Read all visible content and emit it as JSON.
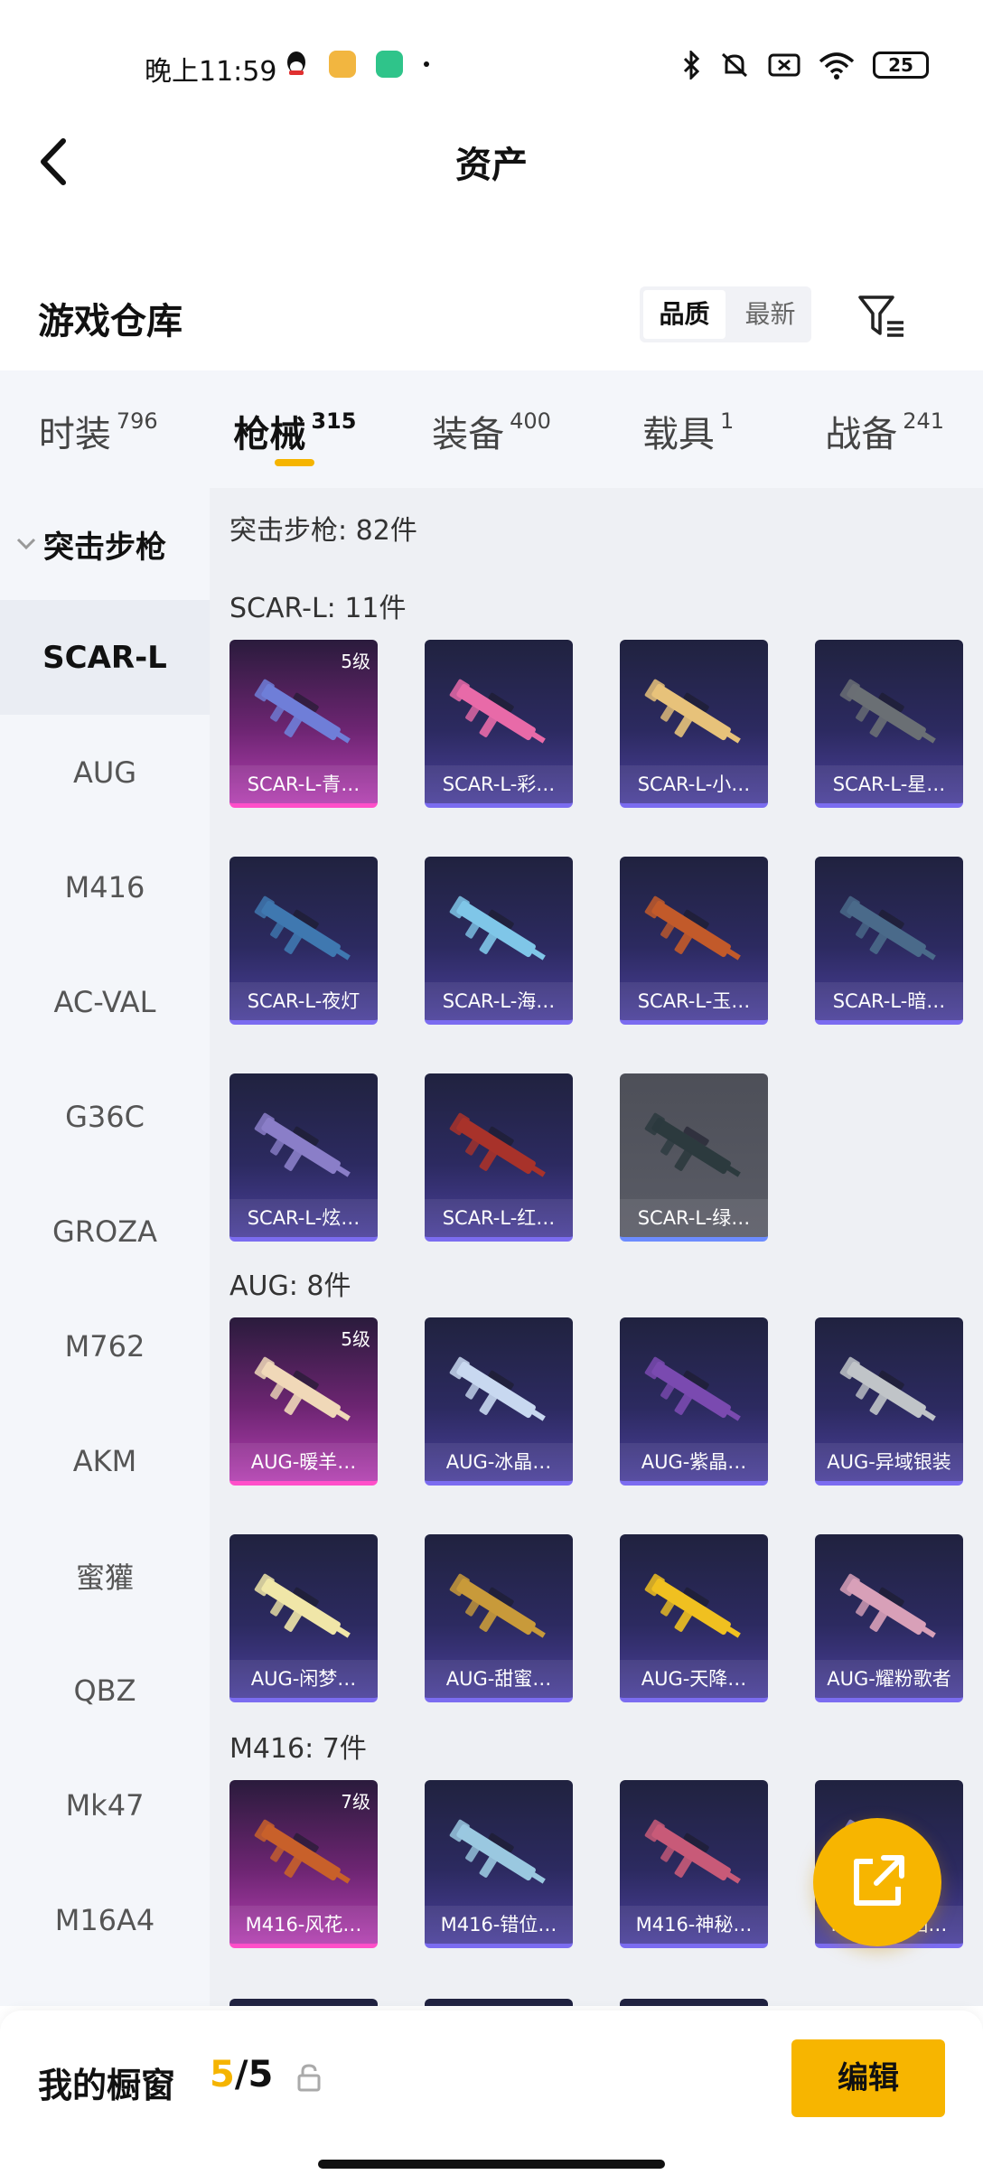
{
  "status_bar": {
    "time": "晚上11:59",
    "battery": "25"
  },
  "nav": {
    "title": "资产"
  },
  "header": {
    "title": "游戏仓库",
    "sort_options": [
      "品质",
      "最新"
    ],
    "sort_active": "品质"
  },
  "tabs": [
    {
      "label": "时装",
      "count": "796"
    },
    {
      "label": "枪械",
      "count": "315",
      "active": true
    },
    {
      "label": "装备",
      "count": "400"
    },
    {
      "label": "载具",
      "count": "1"
    },
    {
      "label": "战备",
      "count": "241"
    }
  ],
  "sidebar": {
    "group": "突击步枪",
    "items": [
      "SCAR-L",
      "AUG",
      "M416",
      "AC-VAL",
      "G36C",
      "GROZA",
      "M762",
      "AKM",
      "蜜獾",
      "QBZ",
      "Mk47",
      "M16A4"
    ],
    "active": "SCAR-L"
  },
  "content": {
    "summary": "突击步枪: 82件",
    "groups": [
      {
        "title": "SCAR-L: 11件",
        "items": [
          {
            "name": "SCAR-L-青…",
            "level": "5级",
            "tier": "gold",
            "color": "#6f7ed8"
          },
          {
            "name": "SCAR-L-彩…",
            "tier": "purple",
            "color": "#e86aa8"
          },
          {
            "name": "SCAR-L-小…",
            "tier": "purple",
            "color": "#e7c27a"
          },
          {
            "name": "SCAR-L-星…",
            "tier": "purple",
            "color": "#6a6f74"
          },
          {
            "name": "SCAR-L-夜灯",
            "tier": "purple",
            "color": "#3f78b0"
          },
          {
            "name": "SCAR-L-海…",
            "tier": "purple",
            "color": "#7fc6e8"
          },
          {
            "name": "SCAR-L-玉…",
            "tier": "purple",
            "color": "#c25a2a"
          },
          {
            "name": "SCAR-L-暗…",
            "tier": "purple",
            "color": "#4a6a8a"
          },
          {
            "name": "SCAR-L-炫…",
            "tier": "purple",
            "color": "#8a7ec8"
          },
          {
            "name": "SCAR-L-红…",
            "tier": "purple",
            "color": "#a8322a"
          },
          {
            "name": "SCAR-L-绿…",
            "tier": "grey",
            "color": "#2c3a3e"
          }
        ]
      },
      {
        "title": "AUG: 8件",
        "items": [
          {
            "name": "AUG-暖羊…",
            "level": "5级",
            "tier": "gold",
            "color": "#f0d8b8"
          },
          {
            "name": "AUG-冰晶…",
            "tier": "purple",
            "color": "#c8d8f0"
          },
          {
            "name": "AUG-紫晶…",
            "tier": "purple",
            "color": "#7a4ab0"
          },
          {
            "name": "AUG-异域银装",
            "tier": "purple",
            "color": "#c0c4c8"
          },
          {
            "name": "AUG-闲梦…",
            "tier": "purple",
            "color": "#f0e6a8"
          },
          {
            "name": "AUG-甜蜜…",
            "tier": "purple",
            "color": "#c89a3a"
          },
          {
            "name": "AUG-天降…",
            "tier": "purple",
            "color": "#f0c020"
          },
          {
            "name": "AUG-耀粉歌者",
            "tier": "purple",
            "color": "#d8a0b8"
          }
        ]
      },
      {
        "title": "M416: 7件",
        "items": [
          {
            "name": "M416-风花…",
            "level": "7级",
            "tier": "gold",
            "color": "#c8602a"
          },
          {
            "name": "M416-错位…",
            "tier": "purple",
            "color": "#9ac8e0"
          },
          {
            "name": "M416-神秘…",
            "tier": "purple",
            "color": "#c85a78"
          },
          {
            "name": "M416-…回…",
            "tier": "purple",
            "color": "#8a8ad0"
          }
        ]
      }
    ]
  },
  "bottom": {
    "title": "我的橱窗",
    "slots_used": "5",
    "slots_sep": "/",
    "slots_total": "5",
    "edit_label": "编辑"
  },
  "colors": {
    "accent": "#f7b500"
  }
}
